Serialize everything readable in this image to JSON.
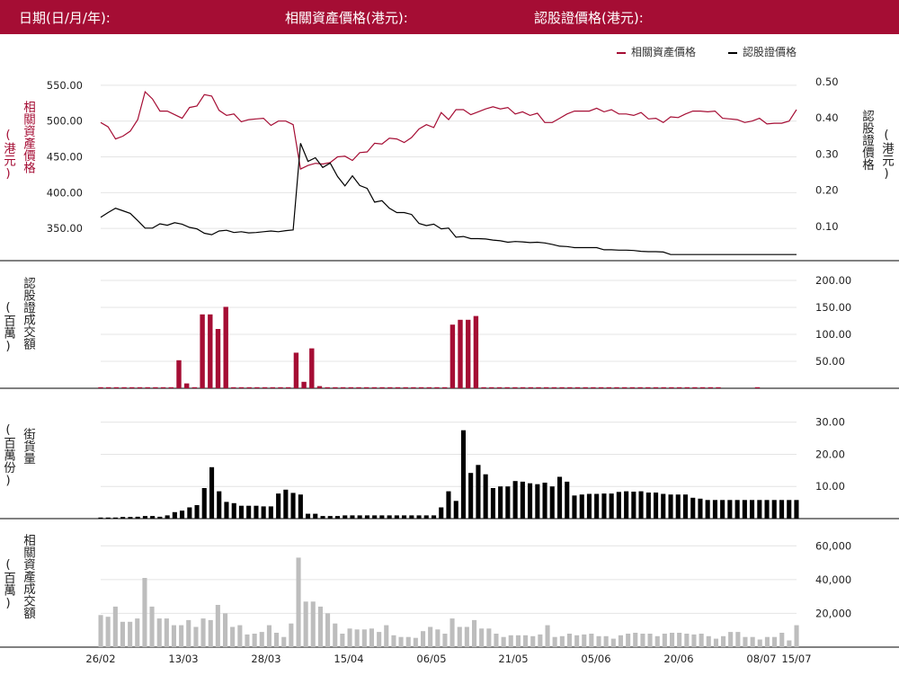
{
  "header": {
    "date_label": "日期(日/月/年):",
    "underlying_label": "相關資產價格(港元):",
    "warrant_label": "認股證價格(港元):",
    "background_color": "#a50d34"
  },
  "legend": {
    "underlying": "相關資產價格",
    "warrant": "認股證價格"
  },
  "panels": {
    "price_left_title": "相關資產價格",
    "price_left_unit": "(港元)",
    "price_right_title": "認股證價格",
    "price_right_unit": "(港元)",
    "turnover_title": "認股證成交額",
    "turnover_unit": "(百萬)",
    "street_title": "街貨量",
    "street_unit": "(百萬份)",
    "underlying_turnover_title": "相關資產成交額",
    "underlying_turnover_unit": "(百萬)"
  },
  "chart_data": {
    "type": "line",
    "x_labels": [
      "26/02",
      "13/03",
      "28/03",
      "15/04",
      "06/05",
      "21/05",
      "05/06",
      "20/06",
      "08/07",
      "15/07"
    ],
    "colors": {
      "underlying": "#a50d34",
      "warrant": "#000000",
      "underlying_turnover": "#bdbdbd"
    },
    "price": {
      "left_ticks": [
        "550.00",
        "500.00",
        "450.00",
        "400.00",
        "350.00"
      ],
      "left_range": [
        305,
        570
      ],
      "right_ticks": [
        "0.50",
        "0.40",
        "0.30",
        "0.20",
        "0.10"
      ],
      "right_range": [
        0.005,
        0.53
      ],
      "underlying": [
        498,
        492,
        475,
        479,
        486,
        502,
        541,
        531,
        514,
        514,
        509,
        504,
        519,
        521,
        537,
        535,
        515,
        508,
        510,
        499,
        502,
        503,
        504,
        494,
        500,
        500,
        495,
        433,
        438,
        441,
        440,
        442,
        450,
        451,
        445,
        456,
        457,
        469,
        468,
        476,
        475,
        470,
        477,
        489,
        495,
        491,
        512,
        502,
        516,
        516,
        509,
        513,
        517,
        520,
        517,
        519,
        510,
        513,
        508,
        511,
        498,
        498,
        504,
        510,
        514,
        514,
        514,
        518,
        513,
        516,
        510,
        510,
        508,
        512,
        503,
        504,
        498,
        506,
        505,
        510,
        514,
        514,
        513,
        514,
        504,
        503,
        502,
        498,
        500,
        504,
        496,
        497,
        497,
        500,
        516
      ],
      "warrant": [
        0.125,
        0.138,
        0.15,
        0.143,
        0.136,
        0.116,
        0.095,
        0.095,
        0.107,
        0.103,
        0.11,
        0.106,
        0.097,
        0.093,
        0.081,
        0.077,
        0.087,
        0.089,
        0.083,
        0.085,
        0.082,
        0.083,
        0.085,
        0.087,
        0.085,
        0.088,
        0.09,
        0.33,
        0.28,
        0.29,
        0.263,
        0.275,
        0.238,
        0.212,
        0.24,
        0.213,
        0.205,
        0.167,
        0.171,
        0.15,
        0.138,
        0.138,
        0.133,
        0.108,
        0.102,
        0.106,
        0.093,
        0.095,
        0.07,
        0.072,
        0.066,
        0.066,
        0.065,
        0.062,
        0.06,
        0.056,
        0.058,
        0.057,
        0.055,
        0.056,
        0.054,
        0.05,
        0.045,
        0.044,
        0.041,
        0.041,
        0.041,
        0.041,
        0.035,
        0.035,
        0.034,
        0.034,
        0.033,
        0.031,
        0.03,
        0.03,
        0.029,
        0.022,
        0.022,
        0.022,
        0.022,
        0.022,
        0.022,
        0.022,
        0.022,
        0.022,
        0.022,
        0.022,
        0.022,
        0.022,
        0.022,
        0.022,
        0.022,
        0.022,
        0.022
      ]
    },
    "warrant_turnover": {
      "ticks": [
        "200.00",
        "150.00",
        "100.00",
        "50.00"
      ],
      "range": [
        0,
        200
      ],
      "values": [
        1,
        1,
        1,
        1,
        1,
        1,
        1,
        1,
        1,
        1,
        52,
        9,
        2,
        137,
        137,
        110,
        151,
        1,
        1,
        1,
        1,
        1,
        1,
        1,
        1,
        66,
        12,
        74,
        4,
        1,
        1,
        1,
        1,
        1,
        1,
        1,
        1,
        1,
        1,
        1,
        1,
        1,
        1,
        1,
        1,
        118,
        127,
        127,
        134,
        1,
        1,
        1,
        1,
        1,
        1,
        1,
        1,
        1,
        1,
        1,
        1,
        1,
        1,
        1,
        1,
        1,
        1,
        1,
        1,
        1,
        1,
        1,
        1,
        1,
        1,
        1,
        1,
        1,
        1,
        1,
        0,
        0,
        0,
        0,
        1,
        0,
        0,
        0,
        0,
        0
      ]
    },
    "street_volume": {
      "ticks": [
        "30.00",
        "20.00",
        "10.00"
      ],
      "range": [
        0,
        33
      ],
      "values": [
        0.2,
        0.2,
        0.2,
        0.5,
        0.5,
        0.6,
        0.8,
        0.8,
        0.6,
        1,
        2,
        2.5,
        3.5,
        4.2,
        9.5,
        16,
        8.5,
        5.2,
        4.8,
        4,
        4,
        4,
        3.8,
        3.8,
        7.8,
        9,
        8,
        7.5,
        1.5,
        1.5,
        0.8,
        0.8,
        0.8,
        1,
        1,
        1,
        1,
        1,
        1,
        1,
        1,
        1,
        1,
        1,
        1,
        1,
        3.5,
        8.5,
        5.5,
        27.5,
        14.2,
        16.7,
        13.8,
        9.5,
        10,
        10,
        11.7,
        11.5,
        11,
        10.7,
        11.2,
        10,
        13,
        11.5,
        7.2,
        7.5,
        7.7,
        7.7,
        7.8,
        7.8,
        8.3,
        8.5,
        8.4,
        8.5,
        8.1,
        8.1,
        7.7,
        7.5,
        7.5,
        7.5,
        6.5,
        6.2,
        5.8,
        5.8,
        5.8,
        5.8,
        5.8,
        5.8,
        5.8,
        5.8,
        5.8,
        5.8,
        5.8,
        5.8,
        5.8
      ]
    },
    "underlying_turnover": {
      "ticks": [
        "60,000",
        "40,000",
        "20,000"
      ],
      "range": [
        0,
        66000
      ],
      "values": [
        19000,
        18000,
        24000,
        15000,
        15000,
        17000,
        41000,
        24000,
        17000,
        17000,
        13000,
        13000,
        16000,
        12000,
        17000,
        16000,
        25000,
        20000,
        12000,
        13000,
        7500,
        8000,
        9000,
        13000,
        8500,
        6000,
        14000,
        53000,
        27000,
        27000,
        24000,
        20000,
        14000,
        8000,
        11000,
        10500,
        10500,
        11000,
        9000,
        13000,
        7000,
        6000,
        6000,
        5500,
        9500,
        12000,
        10500,
        8000,
        17000,
        12000,
        12000,
        16000,
        11000,
        11000,
        8000,
        6000,
        7000,
        7000,
        7000,
        6500,
        7500,
        13000,
        6000,
        6500,
        8000,
        7000,
        7500,
        8000,
        6500,
        6500,
        5000,
        7000,
        8000,
        8500,
        8000,
        8000,
        6500,
        8000,
        8500,
        8500,
        8000,
        7500,
        8000,
        6500,
        5000,
        6500,
        9000,
        9000,
        6000,
        6000,
        4500,
        6000,
        6000,
        8500,
        4000,
        13000
      ]
    }
  }
}
